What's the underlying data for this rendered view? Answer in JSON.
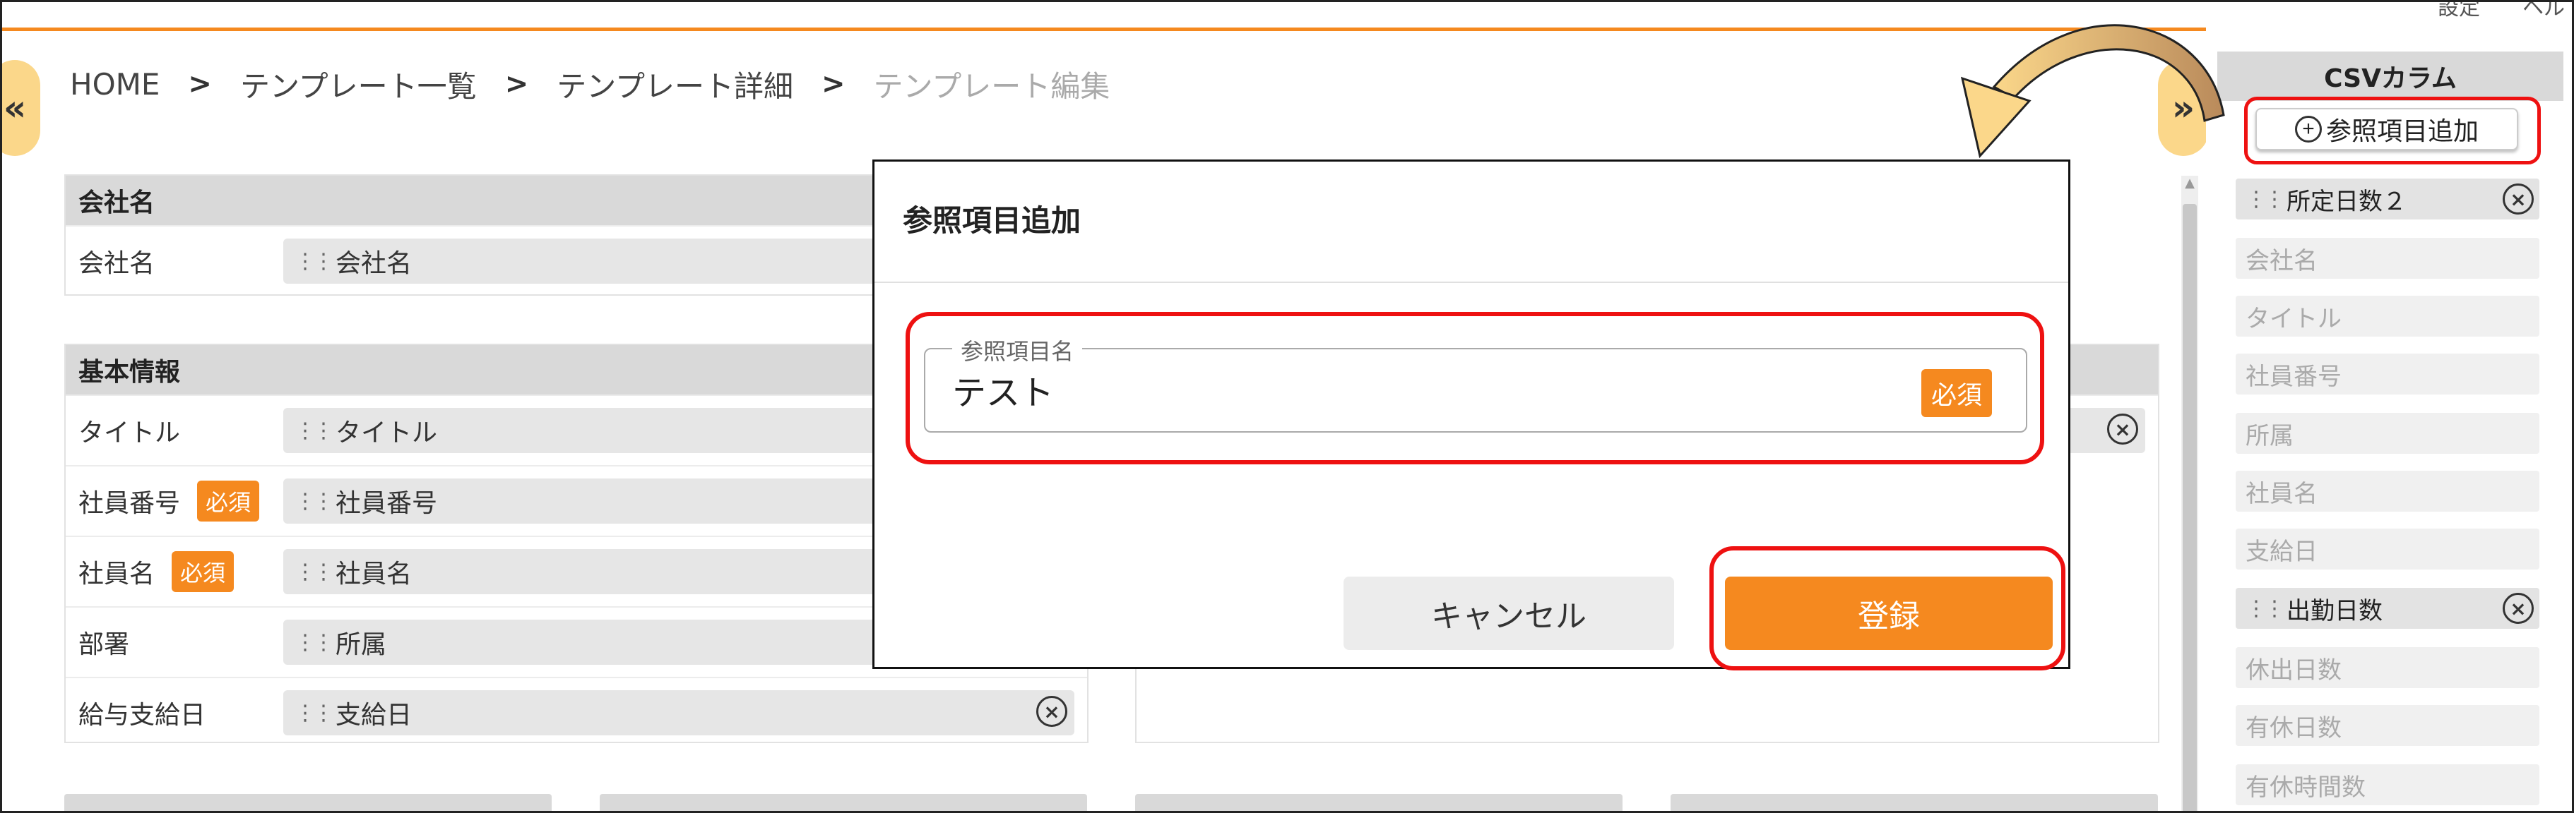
{
  "top_util": {
    "settings": "設定",
    "help": "ヘル"
  },
  "breadcrumb": {
    "home": "HOME",
    "templates": "テンプレート一覧",
    "template_detail": "テンプレート詳細",
    "current": "テンプレート編集",
    "separator": ">"
  },
  "toggles": {
    "left": "«",
    "right": "»"
  },
  "required_label": "必須",
  "company_section": {
    "title": "会社名",
    "rows": [
      {
        "label": "会社名",
        "value": "会社名"
      }
    ]
  },
  "basic_section": {
    "title": "基本情報",
    "rows": [
      {
        "label": "タイトル",
        "value": "タイトル"
      },
      {
        "label": "社員番号",
        "value": "社員番号",
        "required": true
      },
      {
        "label": "社員名",
        "value": "社員名",
        "required": true
      },
      {
        "label": "部署",
        "value": "所属"
      },
      {
        "label": "給与支給日",
        "value": "支給日"
      }
    ]
  },
  "csv_panel": {
    "title": "CSVカラム",
    "add_button": "参照項目追加",
    "items": [
      {
        "label": "所定日数２",
        "active": true
      },
      {
        "label": "会社名",
        "active": false
      },
      {
        "label": "タイトル",
        "active": false
      },
      {
        "label": "社員番号",
        "active": false
      },
      {
        "label": "所属",
        "active": false
      },
      {
        "label": "社員名",
        "active": false
      },
      {
        "label": "支給日",
        "active": false
      },
      {
        "label": "出勤日数",
        "active": true
      },
      {
        "label": "休出日数",
        "active": false
      },
      {
        "label": "有休日数",
        "active": false
      },
      {
        "label": "有休時間数",
        "active": false
      }
    ]
  },
  "modal": {
    "title": "参照項目追加",
    "field_label": "参照項目名",
    "field_value": "テスト",
    "required": "必須",
    "cancel": "キャンセル",
    "submit": "登録"
  },
  "colors": {
    "accent": "#f5891f",
    "highlight": "#ee1111",
    "toggle": "#fbd78a",
    "section_header": "#d9d9d9"
  }
}
